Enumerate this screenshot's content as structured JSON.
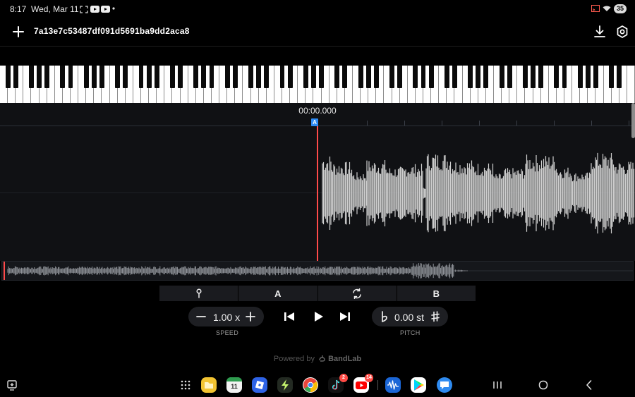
{
  "status_bar": {
    "time": "8:17",
    "date": "Wed, Mar 11",
    "battery": "35"
  },
  "app_bar": {
    "file_name": "7a13e7c53487df091d5691ba9dd2aca8"
  },
  "timeline": {
    "current_time": "00:00.000",
    "marker_a_label": "A",
    "playhead_position": 0
  },
  "ab_toolbar": {
    "a_label": "A",
    "b_label": "B"
  },
  "speed": {
    "value": "1.00 x",
    "label": "SPEED"
  },
  "pitch": {
    "value": "0.00 st",
    "label": "PITCH"
  },
  "footer": {
    "powered_by": "Powered by",
    "brand": "BandLab"
  },
  "dock": {
    "youtube_badge": "14",
    "tiktok_badge": "2",
    "calendar_day": "11"
  },
  "icons": {
    "status_left": [
      "screenshot-icon",
      "youtube-icon",
      "youtube-icon",
      "dot-icon"
    ],
    "status_right": [
      "cast-icon",
      "wifi-icon",
      "battery-icon"
    ],
    "app_bar": [
      "plus-icon",
      "download-icon",
      "settings-hexagon-icon"
    ],
    "ab_toolbar": [
      "pin-icon",
      "loop-ab-icon"
    ],
    "controls": [
      "minus-icon",
      "plus-icon",
      "skip-previous-icon",
      "play-icon",
      "skip-next-icon",
      "flat-icon",
      "sharp-icon"
    ],
    "nav": [
      "screen-capture-icon",
      "app-drawer-icon",
      "recents-icon",
      "home-icon",
      "back-icon"
    ]
  },
  "colors": {
    "background": "#000000",
    "editor_bg": "#101114",
    "playhead": "#ff4a4a",
    "marker_a": "#2f8cf5",
    "waveform": "#cfcfcf",
    "pill_bg": "#1e1f23"
  }
}
